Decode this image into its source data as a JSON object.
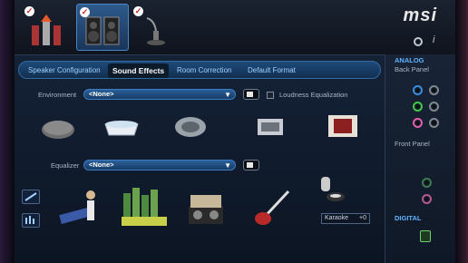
{
  "brand": {
    "logo": "msi"
  },
  "tabs": [
    {
      "label": "Speaker Configuration",
      "active": false
    },
    {
      "label": "Sound Effects",
      "active": true
    },
    {
      "label": "Room Correction",
      "active": false
    },
    {
      "label": "Default Format",
      "active": false
    }
  ],
  "environment": {
    "label": "Environment",
    "value": "<None>",
    "loudness_label": "Loudness Equalization",
    "icons": [
      "sewer-icon",
      "bathtub-icon",
      "stone-corridor-icon",
      "arena-icon",
      "auditorium-icon"
    ]
  },
  "equalizer": {
    "label": "Equalizer",
    "value": "<None>",
    "icons": [
      "pop-keyboard-icon",
      "live-concert-icon",
      "club-icon",
      "rock-guitar-icon",
      "karaoke-mic-icon"
    ]
  },
  "karaoke": {
    "label": "Karaoke",
    "value": "+0"
  },
  "side": {
    "analog": "ANALOG",
    "back_panel": "Back Panel",
    "front_panel": "Front Panel",
    "digital": "DIGITAL"
  },
  "colors": {
    "accent": "#2f6aa3",
    "analog_title": "#5fb3ff",
    "digital_title": "#5fb3ff",
    "jack_blue": "#3a8ee0",
    "jack_green": "#46c84a",
    "jack_pink": "#e060b0",
    "jack_gray": "#808890",
    "jack_front_green": "#3d7a55",
    "jack_front_pink": "#b55a95"
  }
}
